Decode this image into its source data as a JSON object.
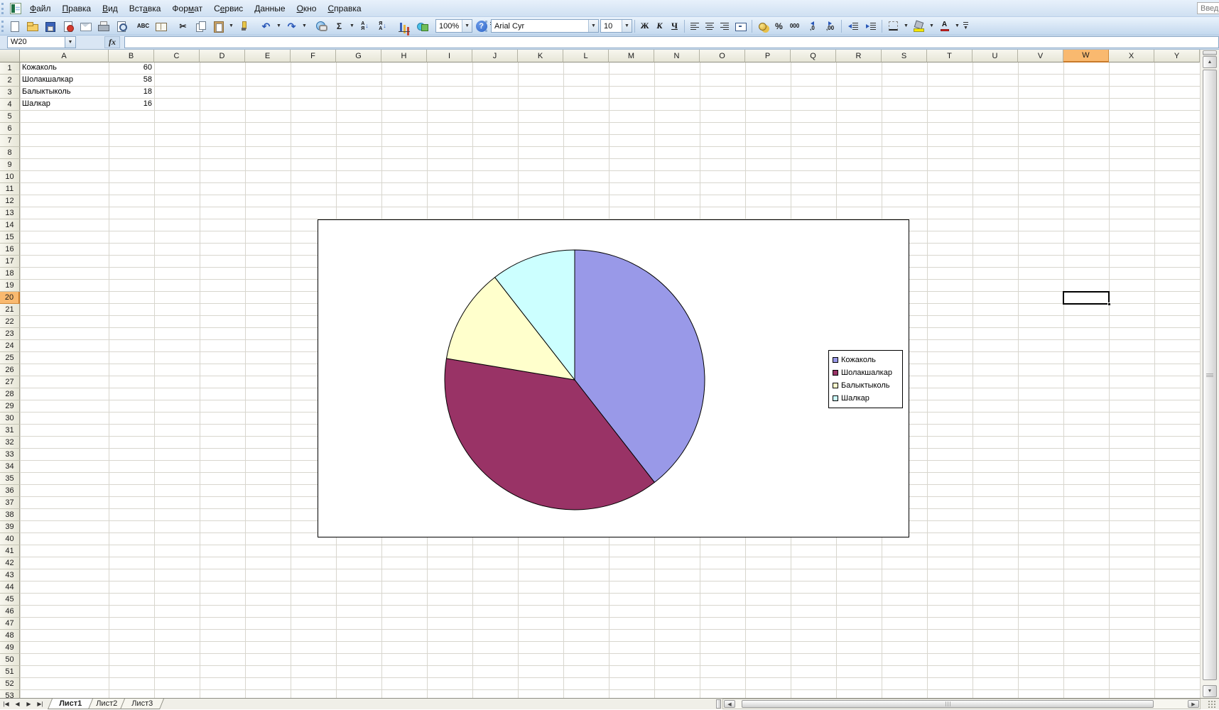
{
  "app": {
    "question_box": "Введ"
  },
  "menu_bar": {
    "items": [
      {
        "label": "Файл",
        "u": 0
      },
      {
        "label": "Правка",
        "u": 0
      },
      {
        "label": "Вид",
        "u": 0
      },
      {
        "label": "Вставка",
        "u": 3
      },
      {
        "label": "Формат",
        "u": 3
      },
      {
        "label": "Сервис",
        "u": 1
      },
      {
        "label": "Данные",
        "u": 0
      },
      {
        "label": "Окно",
        "u": 0
      },
      {
        "label": "Справка",
        "u": 0
      }
    ]
  },
  "standard_toolbar": {
    "cut_glyph": "✂",
    "spelling_label": "ABC",
    "undo_glyph": "↶",
    "redo_glyph": "↷",
    "autosum_label": "Σ",
    "sort_asc_top": "А",
    "sort_asc_bottom": "Я",
    "sort_desc_top": "Я",
    "sort_desc_bottom": "А",
    "zoom_value": "100%",
    "help_label": "?"
  },
  "formatting_toolbar": {
    "font_name": "Arial Cyr",
    "font_size": "10",
    "bold_label": "Ж",
    "italic_label": "К",
    "underline_label": "Ч",
    "percent_label": "%",
    "comma_label": "000",
    "increase_decimal_label": ",0",
    "decrease_decimal_label": ",00",
    "font_color_letter": "А"
  },
  "formula_bar": {
    "name_box_value": "W20",
    "fx_label": "fx",
    "formula_value": ""
  },
  "grid": {
    "column_headers": [
      "A",
      "B",
      "C",
      "D",
      "E",
      "F",
      "G",
      "H",
      "I",
      "J",
      "K",
      "L",
      "M",
      "N",
      "O",
      "P",
      "Q",
      "R",
      "S",
      "T",
      "U",
      "V",
      "W",
      "X",
      "Y"
    ],
    "selected_column": "W",
    "selected_row": 20,
    "selected_cell": "W20",
    "visible_row_count": 53,
    "cells": [
      {
        "row": 1,
        "a": "Кожаколь",
        "b": "60"
      },
      {
        "row": 2,
        "a": "Шолакшалкар",
        "b": "58"
      },
      {
        "row": 3,
        "a": "Балыктыколь",
        "b": "18"
      },
      {
        "row": 4,
        "a": "Шалкар",
        "b": "16"
      }
    ]
  },
  "chart_data": {
    "type": "pie",
    "labels": [
      "Кожаколь",
      "Шолакшалкар",
      "Балыктыколь",
      "Шалкар"
    ],
    "values": [
      60,
      58,
      18,
      16
    ],
    "colors": [
      "#9999E8",
      "#993366",
      "#FFFFCC",
      "#CCFFFF"
    ],
    "slice_border_color": "#000000",
    "legend_position": "right",
    "start_angle_deg": 0,
    "direction": "clockwise",
    "title": ""
  },
  "sheet_tabs": {
    "sheets": [
      "Лист1",
      "Лист2",
      "Лист3"
    ],
    "active_sheet": "Лист1"
  }
}
